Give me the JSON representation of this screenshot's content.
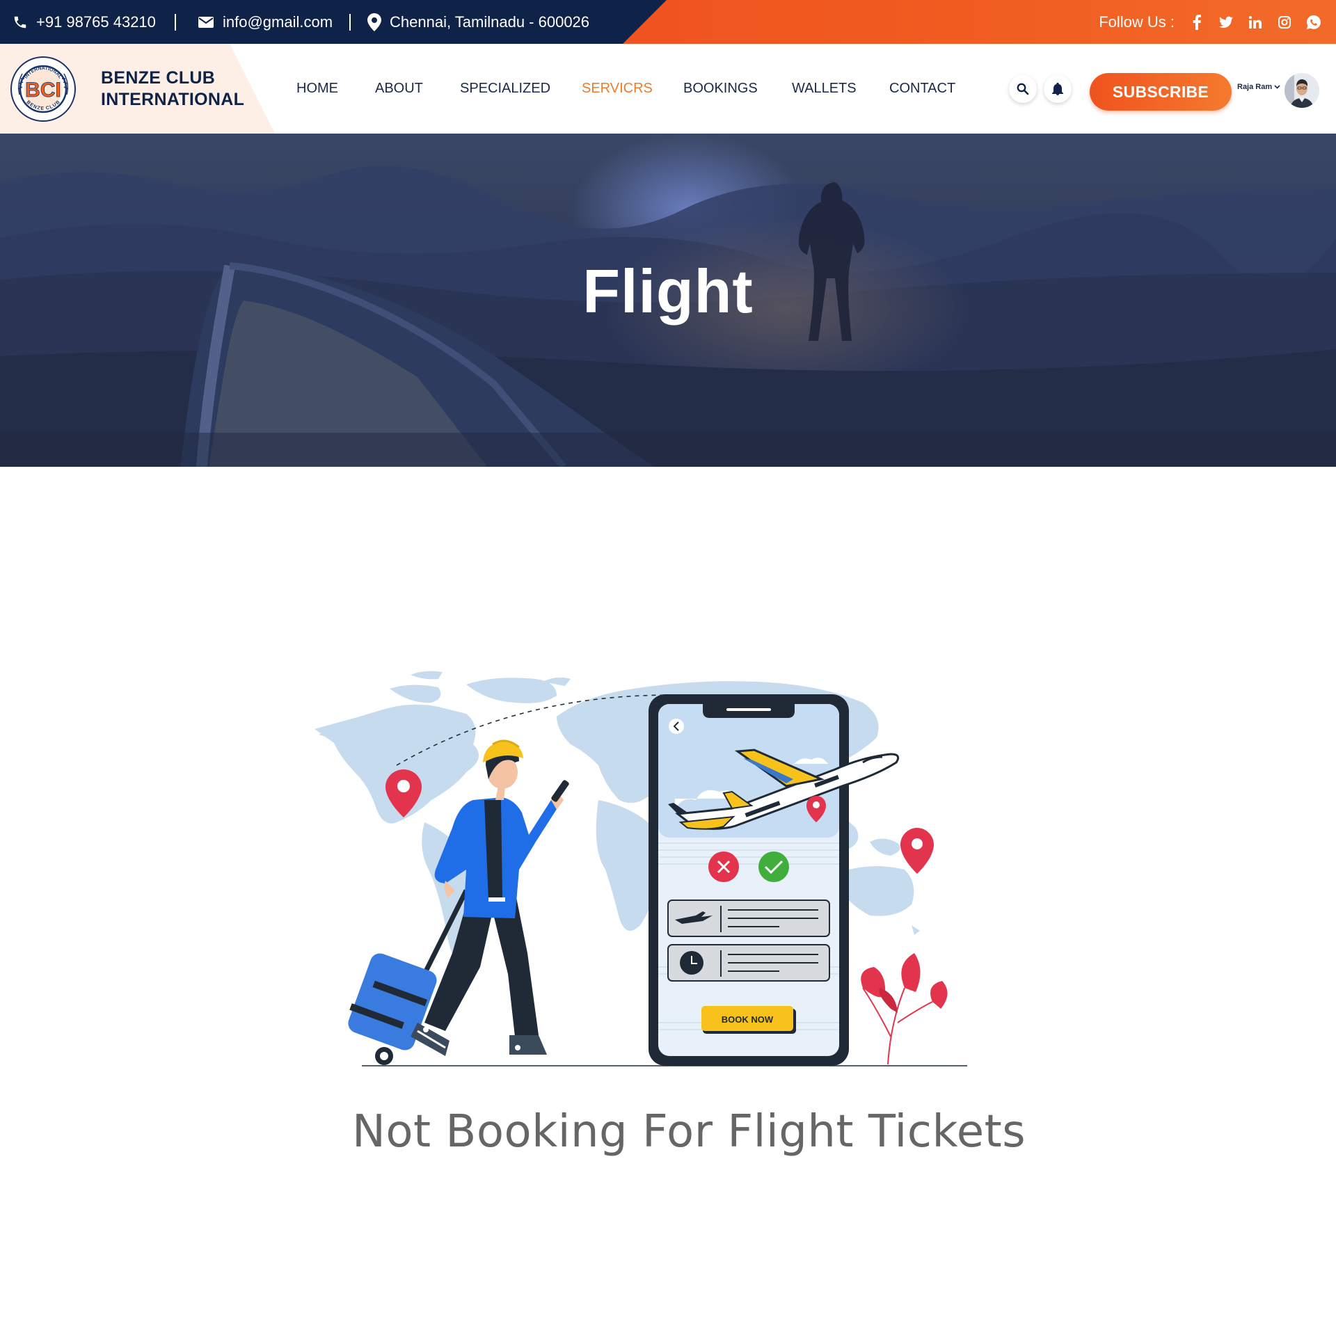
{
  "topbar": {
    "phone": "+91 98765 43210",
    "email": "info@gmail.com",
    "address": "Chennai, Tamilnadu - 600026",
    "follow_label": "Follow Us :",
    "socials": [
      "facebook-icon",
      "twitter-icon",
      "linkedin-icon",
      "instagram-icon",
      "whatsapp-icon"
    ],
    "colors": {
      "dark": "#0f2248",
      "orange": "#f0531e"
    }
  },
  "header": {
    "brand_line1": "BENZE CLUB",
    "brand_line2": "INTERNATIONAL",
    "logo_monogram": "BCI",
    "logo_ring_top": "INTERNATIONAL",
    "logo_ring_bottom": "BENZE CLUB",
    "nav": [
      {
        "label": "HOME",
        "active": false
      },
      {
        "label": "ABOUT",
        "active": false
      },
      {
        "label": "SPECIALIZED",
        "active": false
      },
      {
        "label": "SERVICRS",
        "active": true
      },
      {
        "label": "BOOKINGS",
        "active": false
      },
      {
        "label": "WALLETS",
        "active": false
      },
      {
        "label": "CONTACT",
        "active": false
      }
    ],
    "active_color": "#ee7b2a",
    "subscribe_label": "SUBSCRIBE",
    "user_name": "Raja Ram"
  },
  "hero": {
    "title": "Flight"
  },
  "main": {
    "book_now_label": "BOOK NOW",
    "message": "Not Booking For Flight Tickets"
  }
}
